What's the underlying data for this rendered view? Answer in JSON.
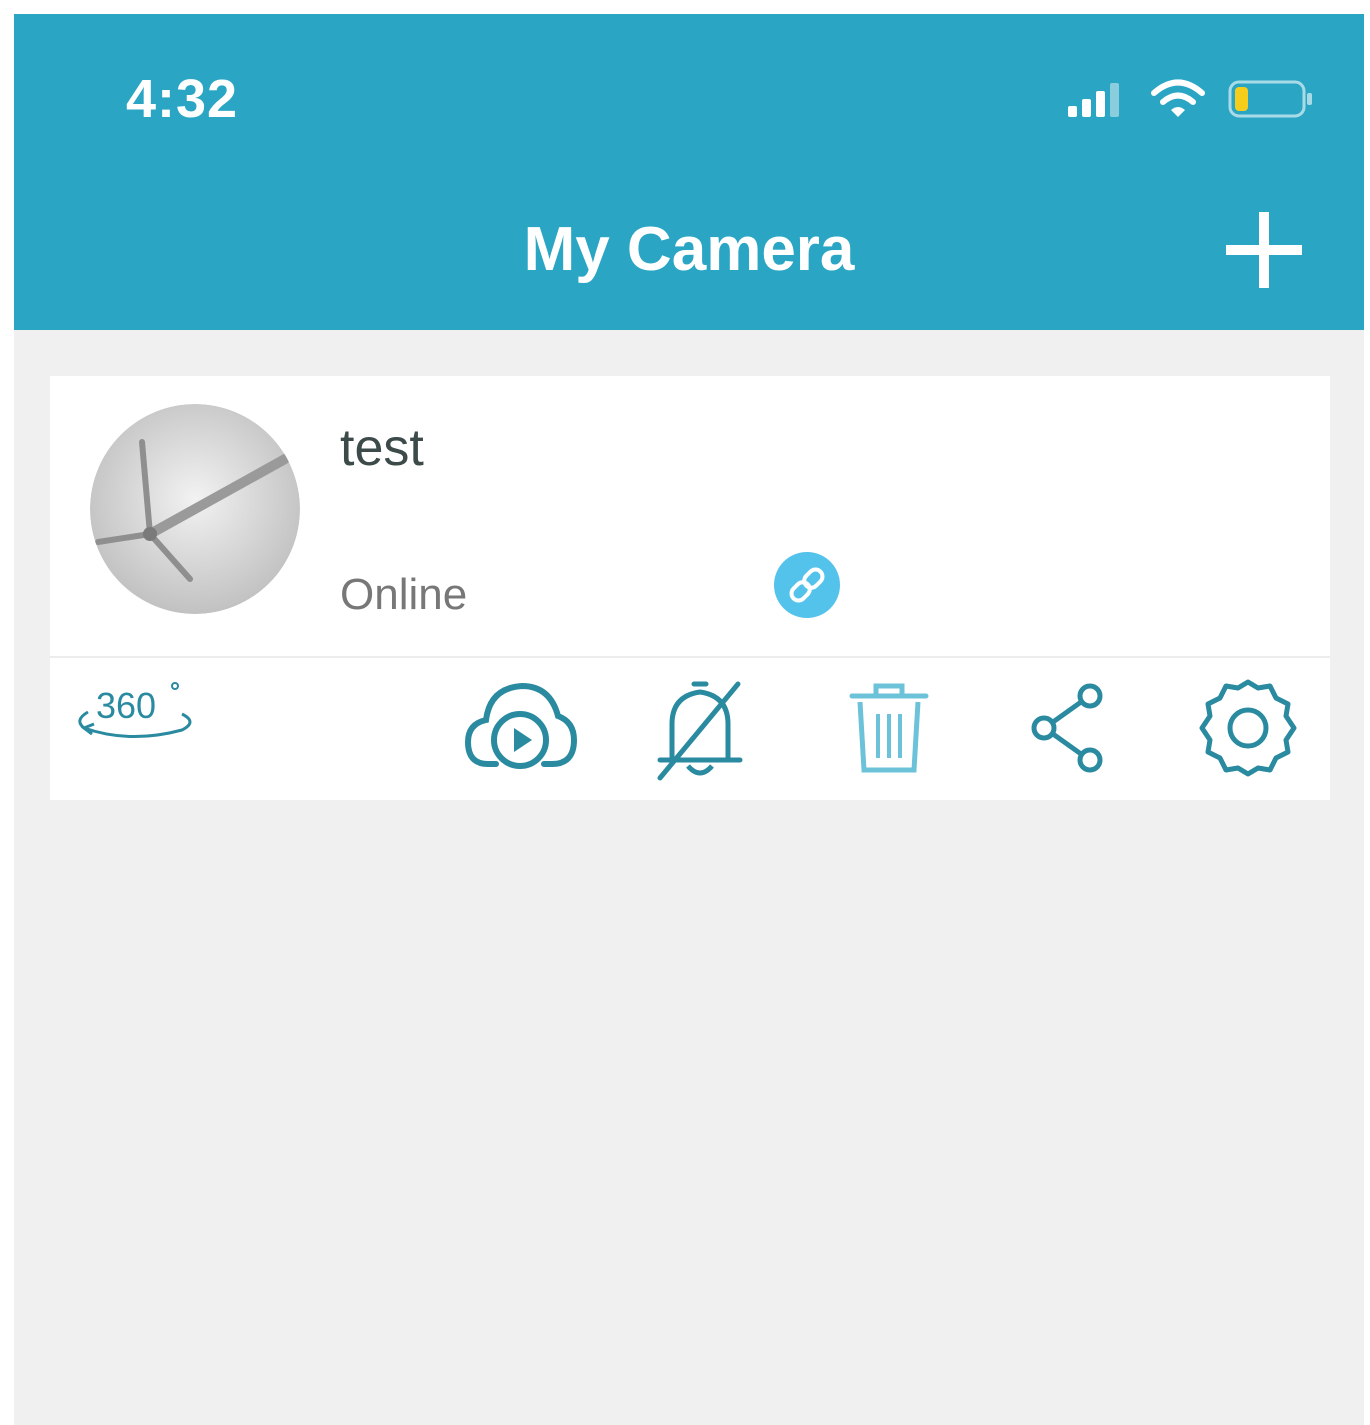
{
  "status_bar": {
    "time": "4:32",
    "icons": [
      "cellular-signal-icon",
      "wifi-icon",
      "battery-low-icon"
    ]
  },
  "header": {
    "title": "My Camera",
    "add_icon": "plus-icon"
  },
  "colors": {
    "header_bg": "#2aa6c4",
    "icon_teal": "#2a8aa0",
    "link_badge": "#53c3ec",
    "battery_level": "#f5cd1a",
    "page_bg": "#f0f0f1"
  },
  "camera_card": {
    "name": "test",
    "status": "Online",
    "thumbnail_icon": "camera-thumbnail",
    "link_icon": "link-icon",
    "actions": [
      {
        "icon": "360-view-icon",
        "label": "360"
      },
      {
        "icon": "cloud-playback-icon"
      },
      {
        "icon": "alarm-off-icon"
      },
      {
        "icon": "trash-icon"
      },
      {
        "icon": "share-icon"
      },
      {
        "icon": "settings-gear-icon"
      }
    ]
  }
}
